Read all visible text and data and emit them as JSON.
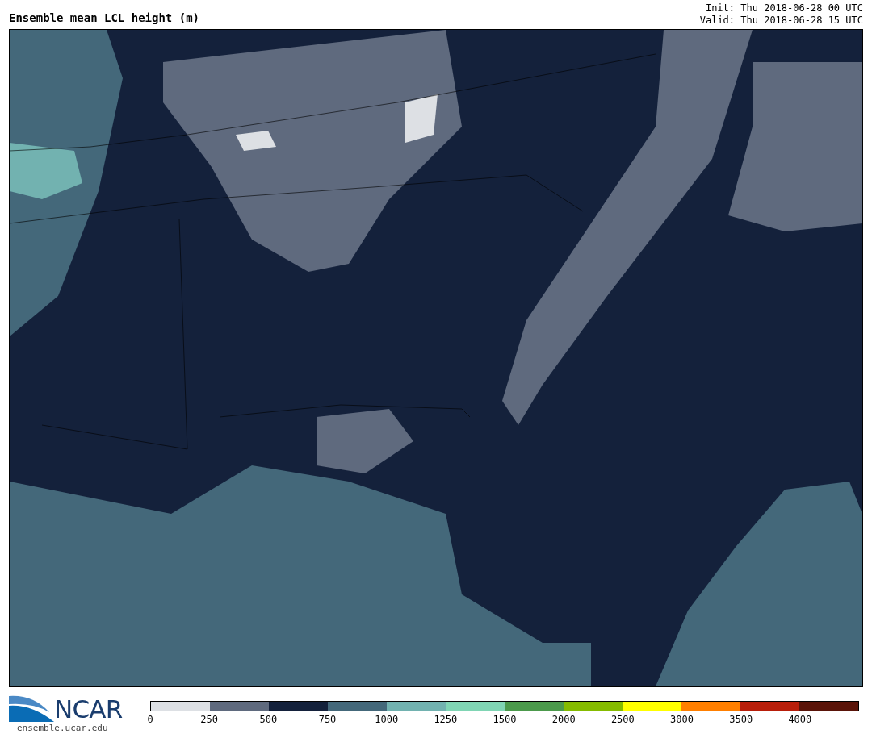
{
  "title": "Ensemble mean LCL height (m)",
  "init": "Init: Thu 2018-06-28 00 UTC",
  "valid": "Valid: Thu 2018-06-28 15 UTC",
  "logo": {
    "text": "NCAR",
    "url": "ensemble.ucar.edu"
  },
  "colorbar": {
    "segments": [
      {
        "color": "#dde0e4",
        "label": "0"
      },
      {
        "color": "#5f6a7e",
        "label": "250"
      },
      {
        "color": "#14213b",
        "label": "500"
      },
      {
        "color": "#44687a",
        "label": "750"
      },
      {
        "color": "#72b2b0",
        "label": "1000"
      },
      {
        "color": "#80d5b4",
        "label": "1250"
      },
      {
        "color": "#4c9a4c",
        "label": "1500"
      },
      {
        "color": "#85bb00",
        "label": "2000"
      },
      {
        "color": "#ffff00",
        "label": "2500"
      },
      {
        "color": "#ff7f00",
        "label": "3000"
      },
      {
        "color": "#b81e0a",
        "label": "3500"
      },
      {
        "color": "#5a1409",
        "label": "4000"
      }
    ]
  }
}
